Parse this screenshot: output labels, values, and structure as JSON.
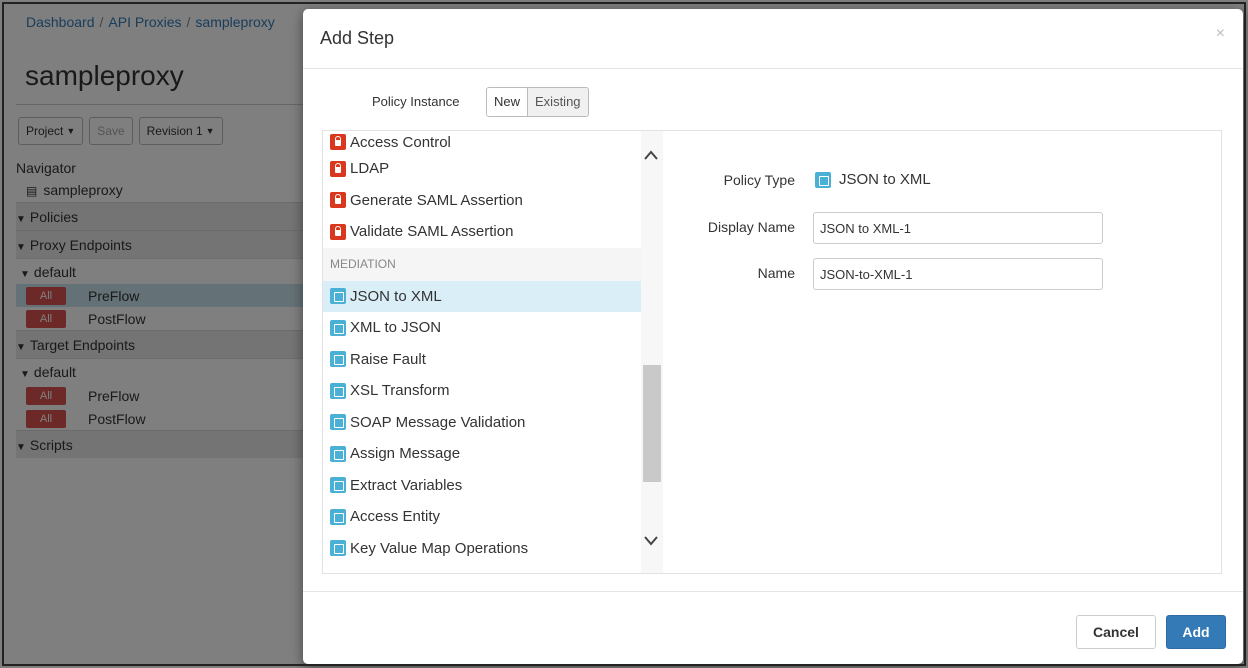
{
  "breadcrumb": {
    "items": [
      "Dashboard",
      "API Proxies",
      "sampleproxy"
    ],
    "separator": "/"
  },
  "proxy_title": "sampleproxy",
  "toolbar": {
    "project_label": "Project",
    "save_label": "Save",
    "revision_label": "Revision 1"
  },
  "navigator": {
    "heading": "Navigator",
    "root_item": "sampleproxy",
    "policies_label": "Policies",
    "proxy_endpoints_label": "Proxy Endpoints",
    "proxy_default_label": "default",
    "proxy_flows": [
      {
        "badge": "All",
        "label": "PreFlow"
      },
      {
        "badge": "All",
        "label": "PostFlow"
      }
    ],
    "target_endpoints_label": "Target Endpoints",
    "target_default_label": "default",
    "target_flows": [
      {
        "badge": "All",
        "label": "PreFlow"
      },
      {
        "badge": "All",
        "label": "PostFlow"
      }
    ],
    "scripts_label": "Scripts"
  },
  "modal": {
    "title": "Add Step",
    "close_glyph": "×",
    "policy_instance": {
      "label": "Policy Instance",
      "options": [
        "New",
        "Existing"
      ],
      "selected": "New"
    },
    "policy_list": {
      "security_items": [
        {
          "label": "Access Control",
          "icon": "lock-icon"
        },
        {
          "label": "LDAP",
          "icon": "lock-icon"
        },
        {
          "label": "Generate SAML Assertion",
          "icon": "lock-icon"
        },
        {
          "label": "Validate SAML Assertion",
          "icon": "lock-icon"
        }
      ],
      "group_label": "MEDIATION",
      "mediation_items": [
        {
          "label": "JSON to XML",
          "icon": "json-to-xml-icon",
          "selected": true
        },
        {
          "label": "XML to JSON",
          "icon": "xml-to-json-icon"
        },
        {
          "label": "Raise Fault",
          "icon": "raise-fault-icon"
        },
        {
          "label": "XSL Transform",
          "icon": "xsl-transform-icon"
        },
        {
          "label": "SOAP Message Validation",
          "icon": "soap-validation-icon"
        },
        {
          "label": "Assign Message",
          "icon": "assign-message-icon"
        },
        {
          "label": "Extract Variables",
          "icon": "extract-variables-icon"
        },
        {
          "label": "Access Entity",
          "icon": "access-entity-icon"
        },
        {
          "label": "Key Value Map Operations",
          "icon": "key-value-map-icon"
        }
      ],
      "scroll_up_glyph": "^",
      "scroll_down_glyph": "v",
      "scroll_position": 0.75
    },
    "detail": {
      "policy_type_label": "Policy Type",
      "policy_type_value": "JSON to XML",
      "display_name_label": "Display Name",
      "display_name_value": "JSON to XML-1",
      "name_label": "Name",
      "name_value": "JSON-to-XML-1"
    },
    "footer": {
      "cancel_label": "Cancel",
      "add_label": "Add"
    }
  },
  "colors": {
    "accent": "#337ab7",
    "badge_red": "#d9534f",
    "lock_red": "#d9381e",
    "selected_row": "#daeef8",
    "mediation_icon": "#4bb0d6"
  }
}
